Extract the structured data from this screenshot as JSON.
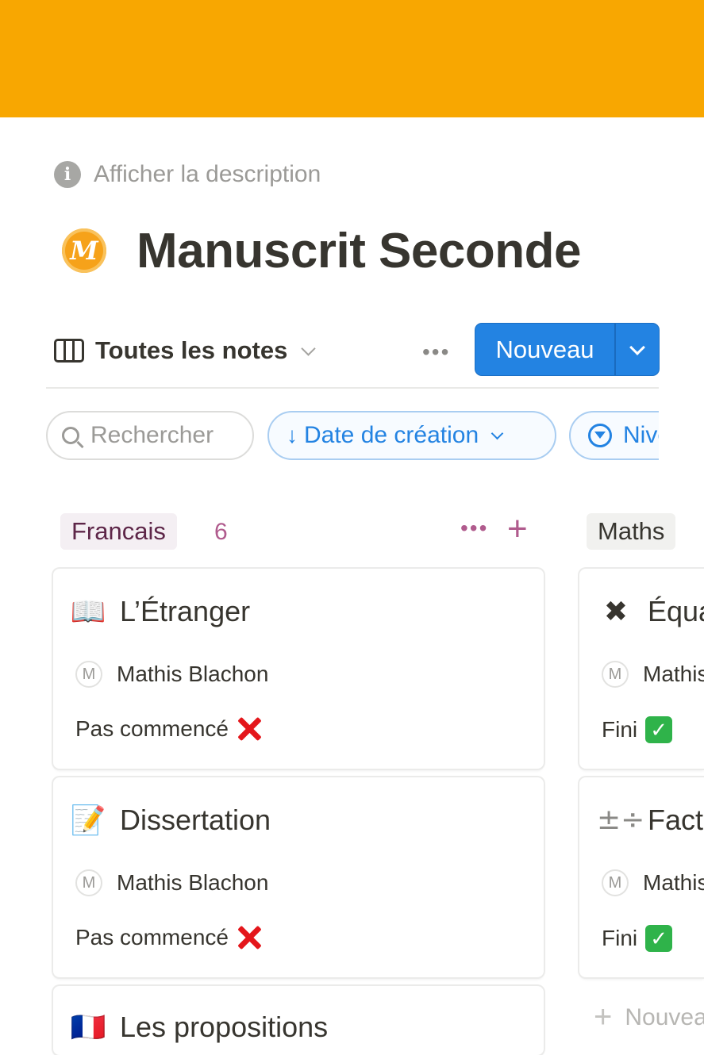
{
  "cover": {
    "color": "#f8a701"
  },
  "description_toggle": {
    "label": "Afficher la description",
    "icon": "info-icon"
  },
  "page": {
    "title": "Manuscrit Seconde",
    "logo_letter": "M"
  },
  "view": {
    "label": "Toutes les notes",
    "icon": "board-icon"
  },
  "toolbar": {
    "more": "•••",
    "new_label": "Nouveau"
  },
  "filters": {
    "search": "Rechercher",
    "sort": "Date de création",
    "level": "Niveau"
  },
  "columns": [
    {
      "tag": "Francais",
      "count": "6",
      "cards": [
        {
          "icon": "📖",
          "title": "L’Étranger",
          "person_initial": "M",
          "person": "Mathis Blachon",
          "status": "Pas commencé"
        },
        {
          "icon": "📝",
          "title": "Dissertation",
          "person_initial": "M",
          "person": "Mathis Blachon",
          "status": "Pas commencé"
        },
        {
          "icon": "🇫🇷",
          "title": "Les propositions"
        }
      ]
    },
    {
      "tag": "Maths",
      "cards": [
        {
          "icon": "✖",
          "title": "Équations",
          "person_initial": "M",
          "person": "Mathis Blachon",
          "status": "Fini"
        },
        {
          "icon": "±÷",
          "title": "Factorisation",
          "person_initial": "M",
          "person": "Mathis Blachon",
          "status": "Fini"
        }
      ],
      "new_label": "Nouveau"
    }
  ],
  "colors": {
    "accent": "#2383e2",
    "francais_tag": "#5d2648",
    "cover": "#f8a701"
  }
}
